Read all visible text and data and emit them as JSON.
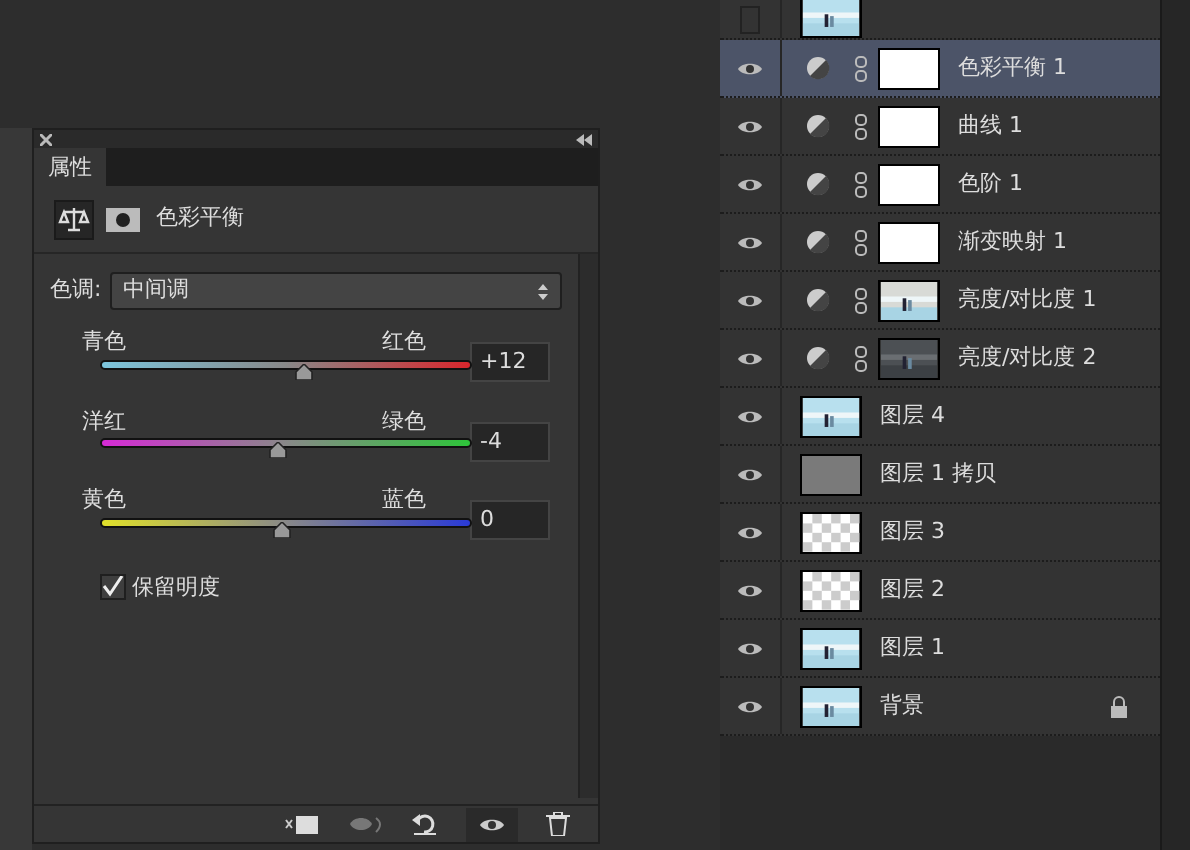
{
  "properties": {
    "tab": "属性",
    "adjustment_title": "色彩平衡",
    "tone": {
      "label": "色调:",
      "value": "中间调"
    },
    "sliders": [
      {
        "kind": "cyan-red",
        "left": "青色",
        "right": "红色",
        "level": 0.55,
        "value": "+12"
      },
      {
        "kind": "magenta-green",
        "left": "洋红",
        "right": "绿色",
        "level": 0.48,
        "value": "-4"
      },
      {
        "kind": "yellow-blue",
        "left": "黄色",
        "right": "蓝色",
        "level": 0.49,
        "value": "0"
      }
    ],
    "preserve_luminosity": {
      "label": "保留明度",
      "checked": true
    }
  },
  "layers": [
    {
      "kind": "pixel",
      "visible": false,
      "selected": false
    },
    {
      "kind": "adjustment",
      "name": "色彩平衡 1",
      "thumbnail": {
        "kind": "white"
      },
      "visible": true,
      "selected": true
    },
    {
      "kind": "adjustment",
      "name": "曲线 1",
      "thumbnail": {
        "kind": "white"
      },
      "visible": true,
      "selected": false
    },
    {
      "kind": "adjustment",
      "name": "色阶 1",
      "thumbnail": {
        "kind": "white"
      },
      "visible": true,
      "selected": false
    },
    {
      "kind": "adjustment",
      "name": "渐变映射 1",
      "thumbnail": {
        "kind": "white"
      },
      "visible": true,
      "selected": false
    },
    {
      "kind": "adjustment",
      "name": "亮度/对比度 1",
      "thumbnail": {
        "kind": "light"
      },
      "visible": true,
      "selected": false
    },
    {
      "kind": "adjustment",
      "name": "亮度/对比度 2",
      "thumbnail": {
        "kind": "dark"
      },
      "visible": true,
      "selected": false
    },
    {
      "kind": "pixel",
      "name": "图层 4",
      "visible": true,
      "selected": false
    },
    {
      "kind": "pixel",
      "name": "图层 1 拷贝",
      "thumbnail": {
        "kind": "gray"
      },
      "visible": true,
      "selected": false
    },
    {
      "kind": "pixel",
      "name": "图层 3",
      "thumbnail": {
        "kind": "transparent"
      },
      "visible": true,
      "selected": false
    },
    {
      "kind": "pixel",
      "name": "图层 2",
      "thumbnail": {
        "kind": "transparent"
      },
      "visible": true,
      "selected": false
    },
    {
      "kind": "pixel",
      "name": "图层 1",
      "visible": true,
      "selected": false
    },
    {
      "kind": "pixel",
      "name": "背景",
      "visible": true,
      "selected": false,
      "locked": true
    }
  ]
}
